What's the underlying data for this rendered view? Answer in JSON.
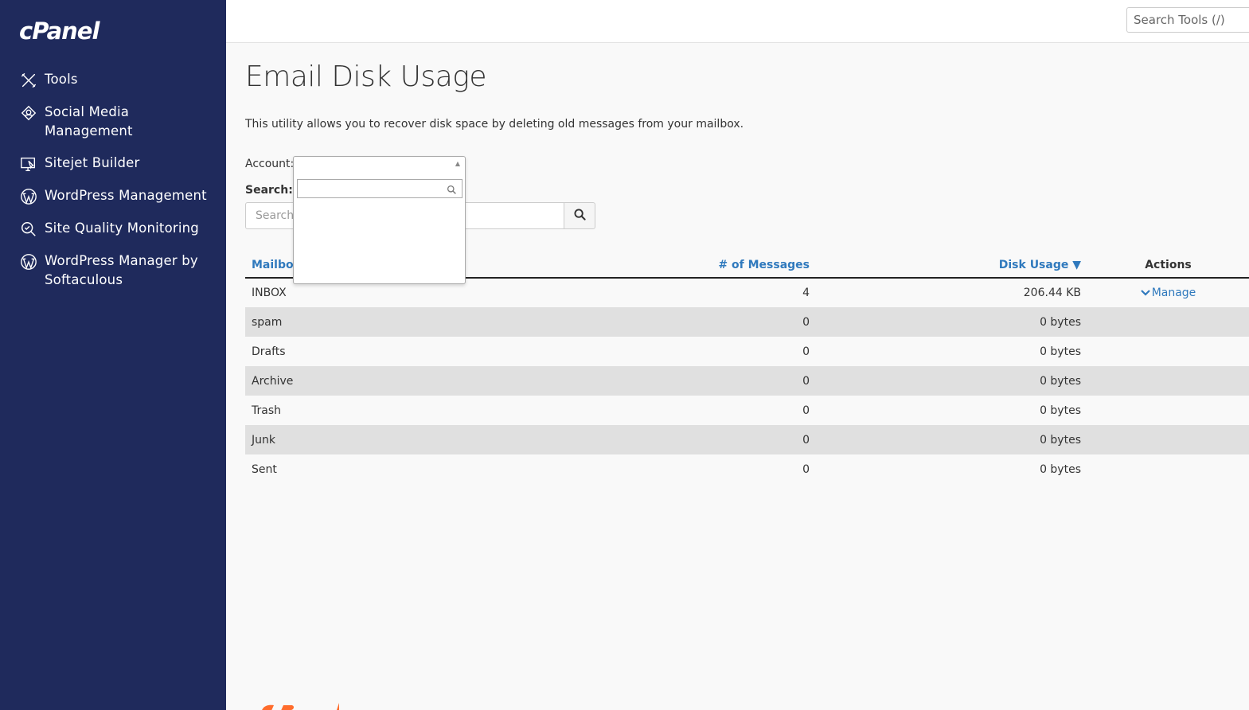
{
  "sidebar": {
    "logo": "cPanel",
    "items": [
      {
        "label": "Tools",
        "icon": "tools-icon"
      },
      {
        "label": "Social Media Management",
        "icon": "social-media-icon"
      },
      {
        "label": "Sitejet Builder",
        "icon": "sitejet-icon"
      },
      {
        "label": "WordPress Management",
        "icon": "wordpress-icon"
      },
      {
        "label": "Site Quality Monitoring",
        "icon": "site-quality-icon"
      },
      {
        "label": "WordPress Manager by Softaculous",
        "icon": "wordpress-icon"
      }
    ]
  },
  "topbar": {
    "search_placeholder": "Search Tools (/)"
  },
  "main": {
    "title": "Email Disk Usage",
    "description": "This utility allows you to recover disk space by deleting old messages from your mailbox.",
    "account_label": "Account:",
    "search_label": "Search:",
    "search_placeholder": "Search"
  },
  "table": {
    "headers": {
      "mailbox": "Mailbox",
      "messages": "# of Messages",
      "disk_usage": "Disk Usage ▼",
      "actions": "Actions"
    },
    "rows": [
      {
        "mailbox": "INBOX",
        "messages": "4",
        "disk_usage": "206.44 KB",
        "action": "Manage"
      },
      {
        "mailbox": "spam",
        "messages": "0",
        "disk_usage": "0 bytes",
        "action": ""
      },
      {
        "mailbox": "Drafts",
        "messages": "0",
        "disk_usage": "0 bytes",
        "action": ""
      },
      {
        "mailbox": "Archive",
        "messages": "0",
        "disk_usage": "0 bytes",
        "action": ""
      },
      {
        "mailbox": "Trash",
        "messages": "0",
        "disk_usage": "0 bytes",
        "action": ""
      },
      {
        "mailbox": "Junk",
        "messages": "0",
        "disk_usage": "0 bytes",
        "action": ""
      },
      {
        "mailbox": "Sent",
        "messages": "0",
        "disk_usage": "0 bytes",
        "action": ""
      }
    ]
  },
  "colors": {
    "sidebar_bg": "#1f2a5c",
    "link": "#2f79bd",
    "brand_orange": "#ff6c2c"
  }
}
